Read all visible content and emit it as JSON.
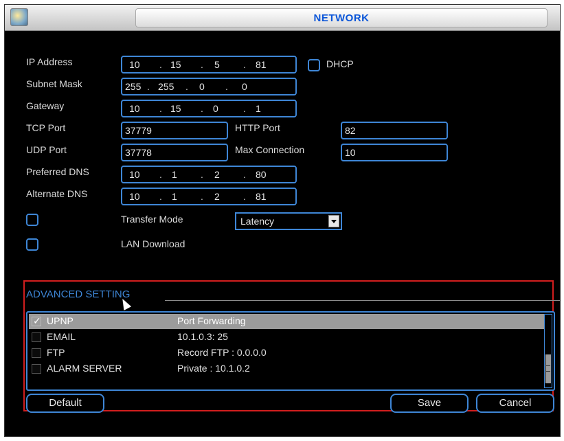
{
  "window": {
    "title": "NETWORK"
  },
  "fields": {
    "ip_address": {
      "label": "IP Address",
      "octets": [
        "10",
        "15",
        "5",
        "81"
      ],
      "dhcp_label": "DHCP"
    },
    "subnet_mask": {
      "label": "Subnet Mask",
      "octets": [
        "255",
        "255",
        "0",
        "0"
      ]
    },
    "gateway": {
      "label": "Gateway",
      "octets": [
        "10",
        "15",
        "0",
        "1"
      ]
    },
    "tcp_port": {
      "label": "TCP Port",
      "value": "37779"
    },
    "http_port": {
      "label": "HTTP Port",
      "value": "82"
    },
    "udp_port": {
      "label": "UDP Port",
      "value": "37778"
    },
    "max_connection": {
      "label": "Max Connection",
      "value": "10"
    },
    "preferred_dns": {
      "label": "Preferred DNS",
      "octets": [
        "10",
        "1",
        "2",
        "80"
      ]
    },
    "alternate_dns": {
      "label": "Alternate DNS",
      "octets": [
        "10",
        "1",
        "2",
        "81"
      ]
    },
    "transfer_mode": {
      "label": "Transfer Mode",
      "value": "Latency"
    },
    "lan_download": {
      "label": "LAN Download"
    }
  },
  "advanced": {
    "title": "ADVANCED SETTING",
    "rows": [
      {
        "name": "UPNP",
        "info": "Port Forwarding",
        "checked": true,
        "selected": true
      },
      {
        "name": "EMAIL",
        "info": "10.1.0.3: 25",
        "checked": false,
        "selected": false
      },
      {
        "name": "FTP",
        "info": "Record FTP : 0.0.0.0",
        "checked": false,
        "selected": false
      },
      {
        "name": "ALARM SERVER",
        "info": "Private : 10.1.0.2",
        "checked": false,
        "selected": false
      }
    ]
  },
  "buttons": {
    "default": "Default",
    "save": "Save",
    "cancel": "Cancel"
  },
  "icons": {
    "app": "network-app-icon",
    "checkbox": "checkbox-icon",
    "dropdown": "chevron-down-icon",
    "check": "checkmark-icon",
    "cursor": "mouse-pointer-icon"
  },
  "colors": {
    "accent": "#3e86d6",
    "highlight_frame": "#d21e1e",
    "background": "#000000",
    "title_text": "#0a55d8",
    "selection": "#9b9b9b"
  }
}
